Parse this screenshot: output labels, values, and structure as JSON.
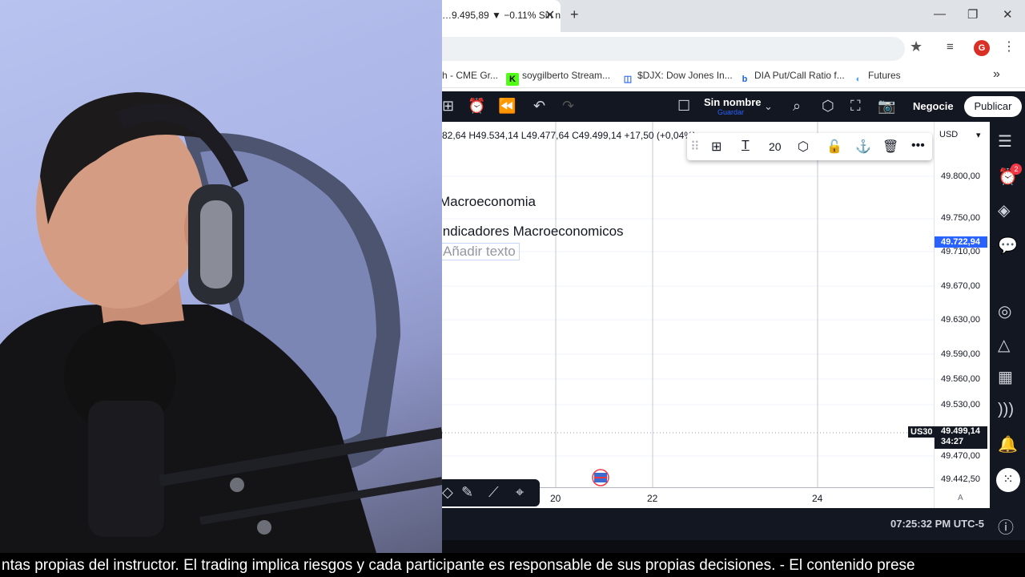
{
  "browser": {
    "tab_title": "…9.495,89 ▼ −0.11% Sin n",
    "new_tab_icon": "plus-icon",
    "window_controls": [
      "minimize-icon",
      "maximize-icon",
      "close-icon"
    ]
  },
  "bookmarks": [
    {
      "label": "h - CME Gr...",
      "icon_color": "#5a5a5a"
    },
    {
      "label": "soygilberto Stream...",
      "icon_color": "#53fc18",
      "icon_text": "K"
    },
    {
      "label": "$DJX: Dow Jones In...",
      "icon_color": "#2962ff",
      "icon_text": "◫"
    },
    {
      "label": "DIA Put/Call Ratio f...",
      "icon_color": "#1a5fff",
      "icon_text": "b"
    },
    {
      "label": "Futures",
      "icon_color": "#4ea3f1",
      "icon_text": "◐"
    }
  ],
  "profile_initial": "G",
  "tradingview": {
    "layout_name": "Sin nombre",
    "layout_save": "Guardar",
    "negocie": "Negocie",
    "publicar": "Publicar"
  },
  "chart": {
    "ohlc": "82,64  H49.534,14  L49.477,64  C49.499,14  +17,50 (+0,04%)",
    "text_line1": "Macroeconomia",
    "text_line2": "Indicadores Macroeconomicos",
    "add_text_placeholder": "Añadir texto",
    "currency": "USD",
    "price_labels": [
      "49.800,00",
      "49.750,00",
      "49.710,00",
      "49.670,00",
      "49.630,00",
      "49.590,00",
      "49.560,00",
      "49.530,00",
      "49.470,00",
      "49.442,50"
    ],
    "highlight_price": "49.722,94",
    "last_price": "49.499,14",
    "countdown": "34:27",
    "symbol": "US30",
    "time_labels": [
      "20",
      "22",
      "24"
    ],
    "auto_label": "A",
    "clock": "07:25:32 PM UTC-5"
  },
  "text_toolbar": {
    "font_size": "20"
  },
  "alerts_badge": "2",
  "ticker_text": "ntas propias del instructor. El trading implica riesgos y cada participante es responsable de sus propias decisiones.  - El contenido prese"
}
